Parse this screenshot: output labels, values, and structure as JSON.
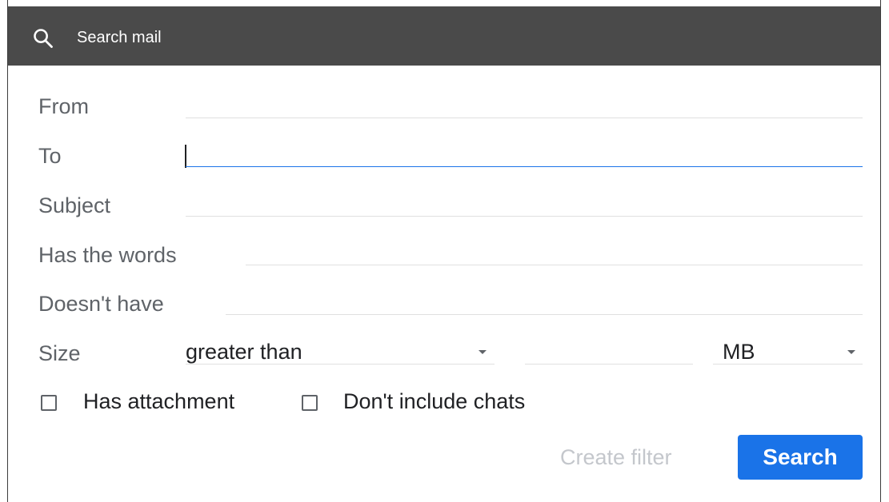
{
  "search": {
    "placeholder": "Search mail",
    "icon": "search-icon"
  },
  "fields": {
    "from": {
      "label": "From",
      "value": ""
    },
    "to": {
      "label": "To",
      "value": ""
    },
    "subject": {
      "label": "Subject",
      "value": ""
    },
    "has_words": {
      "label": "Has the words",
      "value": ""
    },
    "doesnt_have": {
      "label": "Doesn't have",
      "value": ""
    }
  },
  "size": {
    "label": "Size",
    "operator": "greater than",
    "value": "",
    "unit": "MB"
  },
  "checkboxes": {
    "has_attachment": {
      "label": "Has attachment",
      "checked": false
    },
    "dont_include_chats": {
      "label": "Don't include chats",
      "checked": false
    }
  },
  "actions": {
    "create_filter": "Create filter",
    "search": "Search"
  },
  "colors": {
    "header_bg": "#4a4a4a",
    "primary": "#1a73e8",
    "label_text": "#5f6368",
    "disabled_text": "#c4c7cc"
  }
}
